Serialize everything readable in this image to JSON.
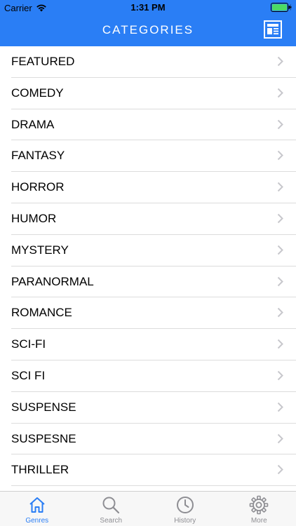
{
  "status_bar": {
    "carrier": "Carrier",
    "time": "1:31 PM"
  },
  "nav": {
    "title": "CATEGORIES",
    "right_icon": "news-icon"
  },
  "categories": [
    "FEATURED",
    "COMEDY",
    "DRAMA",
    "FANTASY",
    "HORROR",
    "HUMOR",
    "MYSTERY",
    "PARANORMAL",
    "ROMANCE",
    "SCI-FI",
    "SCI FI",
    "SUSPENSE",
    "SUSPESNE",
    "THRILLER"
  ],
  "tabs": [
    {
      "label": "Genres",
      "icon": "home-icon",
      "active": true
    },
    {
      "label": "Search",
      "icon": "search-icon",
      "active": false
    },
    {
      "label": "History",
      "icon": "clock-icon",
      "active": false
    },
    {
      "label": "More",
      "icon": "gear-icon",
      "active": false
    }
  ],
  "colors": {
    "accent": "#2a7ef5",
    "battery": "#4cd964",
    "inactive_tab": "#8e8e93",
    "separator": "#dcdcdc"
  }
}
